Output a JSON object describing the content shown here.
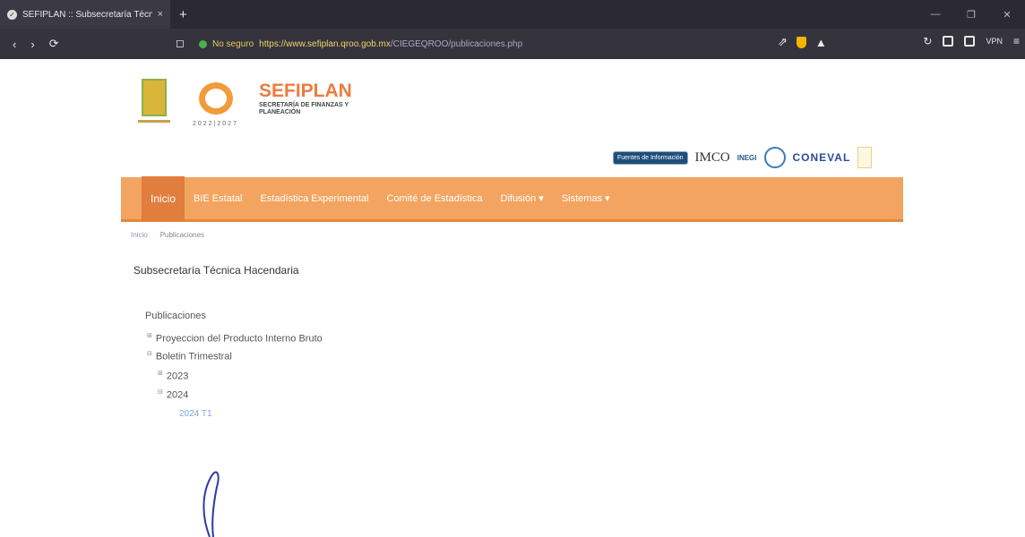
{
  "browser": {
    "tab_title": "SEFIPLAN :: Subsecretaría Técni",
    "tab_close": "×",
    "new_tab": "+",
    "url_security": "No seguro",
    "url_host": "https://www.sefiplan.qroo.gob.mx",
    "url_path": "/CIEGEQROO/publicaciones.php",
    "vpn_label": "VPN"
  },
  "header": {
    "brand": "SEFIPLAN",
    "brand_sub": "SECRETARÍA DE FINANZAS Y PLANEACIÓN",
    "years": "2022|2027",
    "fuentes_label": "Fuentes de Información",
    "imco": "IMCO",
    "inegi": "INEGI",
    "coneval": "CONEVAL"
  },
  "nav": {
    "items": [
      "Inicio",
      "BIE Estatal",
      "Estadística Experimental",
      "Comité de Estadística",
      "Difusión ▾",
      "Sistemas ▾"
    ]
  },
  "breadcrumb": [
    "Inicio",
    "Publicaciones"
  ],
  "heading": "Subsecretaría Técnica Hacendaria",
  "tree": {
    "root": "Publicaciones",
    "item_pib": "Proyeccion del Producto Interno Bruto",
    "item_boletin": "Boletin Trimestral",
    "year_2023": "2023",
    "year_2024": "2024",
    "leaf_2024t1": "2024 T1",
    "toggle_open": "⊟",
    "toggle_closed": "⊞"
  },
  "colors": {
    "nav_bg": "#f2a460",
    "nav_active": "#e17d3d",
    "brand": "#ea7d3e",
    "link": "#7ea7d9"
  }
}
